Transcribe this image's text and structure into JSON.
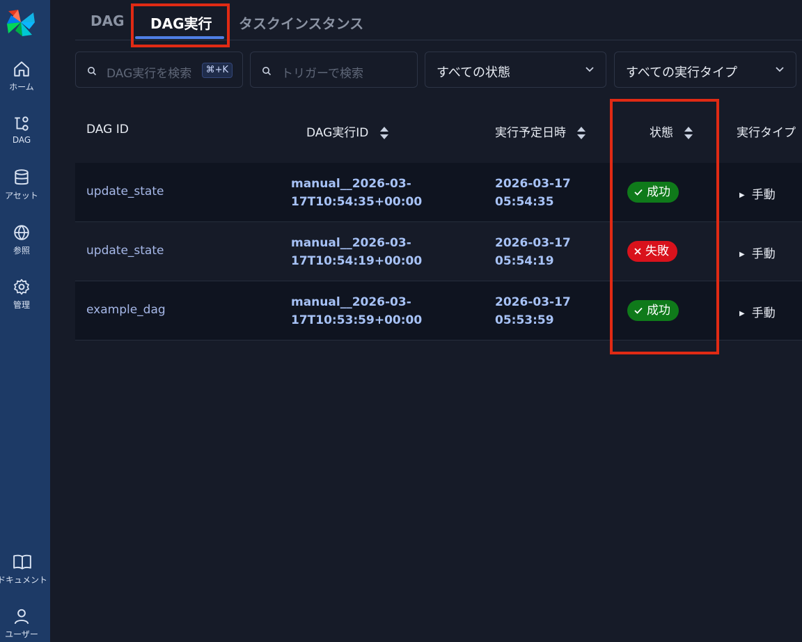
{
  "sidebar": {
    "items": [
      {
        "label": "ホーム",
        "icon": "home-icon"
      },
      {
        "label": "DAG",
        "icon": "dag-icon"
      },
      {
        "label": "アセット",
        "icon": "database-icon"
      },
      {
        "label": "参照",
        "icon": "globe-icon"
      },
      {
        "label": "管理",
        "icon": "gear-icon"
      },
      {
        "label": "ドキュメント",
        "icon": "book-icon"
      },
      {
        "label": "ユーザー",
        "icon": "user-icon"
      }
    ]
  },
  "tabs": [
    {
      "label": "DAG"
    },
    {
      "label": "DAG実行",
      "active": true
    },
    {
      "label": "タスクインスタンス"
    }
  ],
  "filters": {
    "search_runs_placeholder": "DAG実行を検索",
    "shortcut": "⌘+K",
    "search_trigger_placeholder": "トリガーで検索",
    "state_select": "すべての状態",
    "run_type_select": "すべての実行タイプ"
  },
  "table": {
    "headers": {
      "dag_id": "DAG ID",
      "run_id": "DAG実行ID",
      "logical_date": "実行予定日時",
      "state": "状態",
      "run_type": "実行タイプ"
    },
    "rows": [
      {
        "dag_id": "update_state",
        "run_id_1": "manual__2026-03-",
        "run_id_2": "17T10:54:35+00:00",
        "date_1": "2026-03-17",
        "date_2": "05:54:35",
        "state": "成功",
        "state_kind": "success",
        "run_type": "手動"
      },
      {
        "dag_id": "update_state",
        "run_id_1": "manual__2026-03-",
        "run_id_2": "17T10:54:19+00:00",
        "date_1": "2026-03-17",
        "date_2": "05:54:19",
        "state": "失敗",
        "state_kind": "failed",
        "run_type": "手動"
      },
      {
        "dag_id": "example_dag",
        "run_id_1": "manual__2026-03-",
        "run_id_2": "17T10:53:59+00:00",
        "date_1": "2026-03-17",
        "date_2": "05:53:59",
        "state": "成功",
        "state_kind": "success",
        "run_type": "手動"
      }
    ]
  },
  "colors": {
    "success": "#0f7a1a",
    "failed": "#d9121c",
    "accent": "#4f7fe6",
    "highlight": "#e02a14"
  }
}
